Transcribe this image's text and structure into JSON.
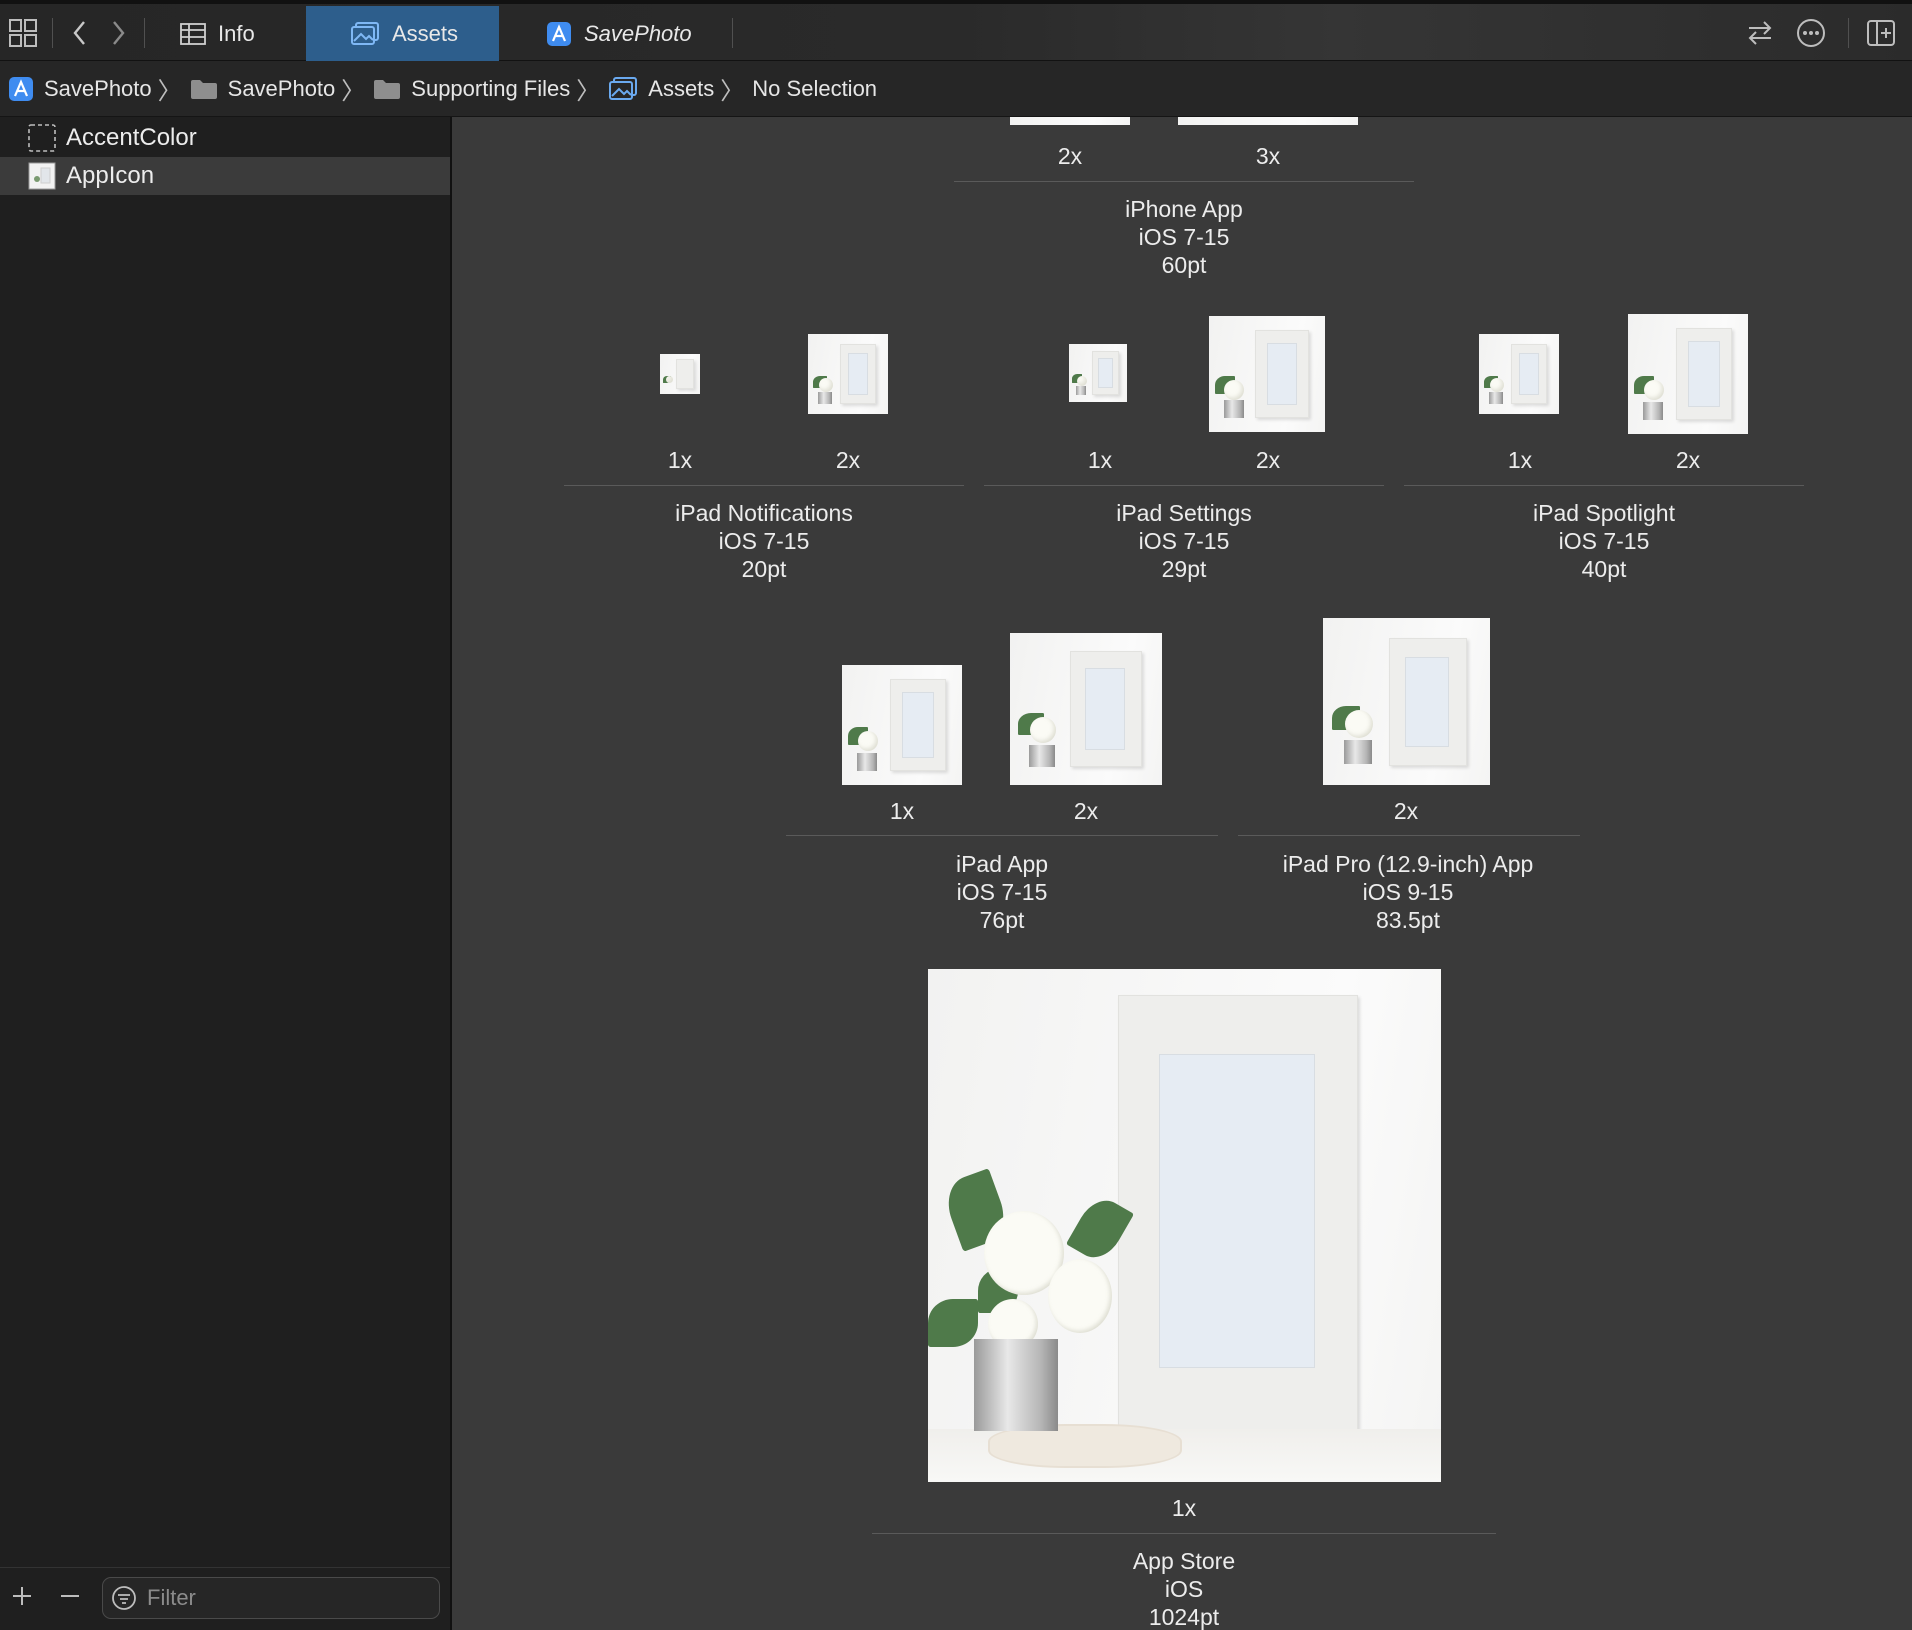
{
  "toolbar": {
    "tabs": [
      {
        "label": "Info",
        "icon": "table-icon"
      },
      {
        "label": "Assets",
        "icon": "assets-catalog-icon"
      },
      {
        "label": "SavePhoto",
        "icon": "app-target-icon"
      }
    ]
  },
  "breadcrumbs": [
    {
      "label": "SavePhoto",
      "icon": "app-target-icon"
    },
    {
      "label": "SavePhoto",
      "icon": "folder-icon"
    },
    {
      "label": "Supporting Files",
      "icon": "folder-icon"
    },
    {
      "label": "Assets",
      "icon": "assets-catalog-icon"
    },
    {
      "label": "No Selection",
      "icon": ""
    }
  ],
  "sidebar": {
    "items": [
      {
        "label": "AccentColor",
        "icon": "color-set-icon"
      },
      {
        "label": "AppIcon",
        "icon": "app-icon-set-icon"
      }
    ],
    "filter_placeholder": "Filter"
  },
  "groups": {
    "iphone_app": {
      "scales": [
        "2x",
        "3x"
      ],
      "name": "iPhone App",
      "os": "iOS 7-15",
      "size": "60pt"
    },
    "ipad_notifications": {
      "scales": [
        "1x",
        "2x"
      ],
      "name": "iPad Notifications",
      "os": "iOS 7-15",
      "size": "20pt"
    },
    "ipad_settings": {
      "scales": [
        "1x",
        "2x"
      ],
      "name": "iPad Settings",
      "os": "iOS 7-15",
      "size": "29pt"
    },
    "ipad_spotlight": {
      "scales": [
        "1x",
        "2x"
      ],
      "name": "iPad Spotlight",
      "os": "iOS 7-15",
      "size": "40pt"
    },
    "ipad_app": {
      "scales": [
        "1x",
        "2x"
      ],
      "name": "iPad App",
      "os": "iOS 7-15",
      "size": "76pt"
    },
    "ipad_pro_app": {
      "scales": [
        "2x"
      ],
      "name": "iPad Pro (12.9-inch) App",
      "os": "iOS 9-15",
      "size": "83.5pt"
    },
    "app_store": {
      "scales": [
        "1x"
      ],
      "name": "App Store",
      "os": "iOS",
      "size": "1024pt"
    }
  },
  "colors": {
    "selected_tab": "#2d5e8c",
    "sidebar_bg": "#1f1f1f",
    "editor_bg": "#3a3a3a",
    "accent_icon": "#3f8cf0"
  }
}
